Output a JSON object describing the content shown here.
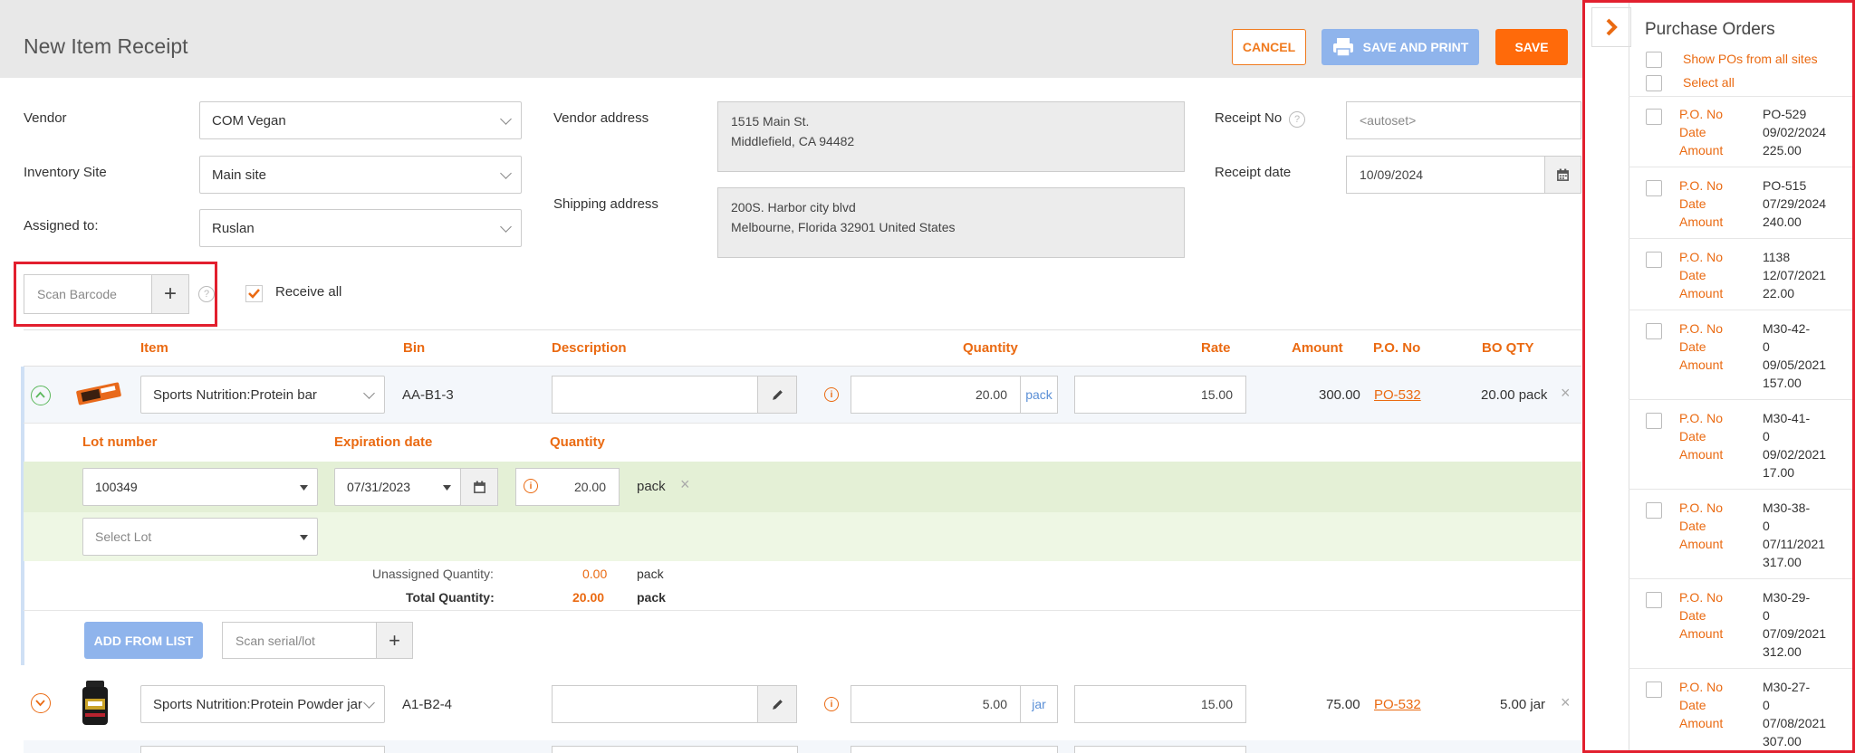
{
  "header": {
    "title": "New Item Receipt",
    "cancel_label": "CANCEL",
    "save_print_label": "SAVE AND PRINT",
    "save_label": "SAVE"
  },
  "form": {
    "vendor_label": "Vendor",
    "vendor_value": "COM Vegan",
    "site_label": "Inventory Site",
    "site_value": "Main site",
    "assigned_label": "Assigned to:",
    "assigned_value": "Ruslan",
    "vendor_address_label": "Vendor address",
    "vendor_address_line1": "1515 Main St.",
    "vendor_address_line2": "Middlefield, CA 94482",
    "shipping_address_label": "Shipping address",
    "shipping_address_line1": "200S. Harbor city blvd",
    "shipping_address_line2": "Melbourne, Florida 32901 United States",
    "receipt_no_label": "Receipt No",
    "receipt_no_placeholder": "<autoset>",
    "receipt_date_label": "Receipt date",
    "receipt_date_value": "10/09/2024",
    "scan_placeholder": "Scan Barcode",
    "receive_all_label": "Receive all"
  },
  "table": {
    "headers": {
      "item": "Item",
      "bin": "Bin",
      "description": "Description",
      "quantity": "Quantity",
      "rate": "Rate",
      "amount": "Amount",
      "po_no": "P.O. No",
      "bo_qty": "BO QTY"
    },
    "row1": {
      "item": "Sports Nutrition:Protein bar",
      "bin": "AA-B1-3",
      "quantity": "20.00",
      "unit": "pack",
      "rate": "15.00",
      "amount": "300.00",
      "po": "PO-532",
      "bo": "20.00 pack"
    },
    "lots": {
      "lot_header": "Lot number",
      "exp_header": "Expiration date",
      "qty_header": "Quantity",
      "lot_value": "100349",
      "exp_value": "07/31/2023",
      "qty_value": "20.00",
      "unit": "pack",
      "select_placeholder": "Select Lot",
      "unassigned_label": "Unassigned Quantity:",
      "unassigned_value": "0.00",
      "unassigned_unit": "pack",
      "total_label": "Total Quantity:",
      "total_value": "20.00",
      "total_unit": "pack",
      "add_from_list": "ADD FROM LIST",
      "scan_serial_placeholder": "Scan serial/lot"
    },
    "row2": {
      "item": "Sports Nutrition:Protein Powder jar",
      "bin": "A1-B2-4",
      "quantity": "5.00",
      "unit": "jar",
      "rate": "15.00",
      "amount": "75.00",
      "po": "PO-532",
      "bo": "5.00 jar"
    }
  },
  "sidebar": {
    "title": "Purchase Orders",
    "show_all_sites": "Show POs from all sites",
    "select_all": "Select all",
    "label_po": "P.O. No",
    "label_date": "Date",
    "label_amount": "Amount",
    "orders": [
      {
        "po": "PO-529",
        "date": "09/02/2024",
        "amount": "225.00"
      },
      {
        "po": "PO-515",
        "date": "07/29/2024",
        "amount": "240.00"
      },
      {
        "po": "1138",
        "date": "12/07/2021",
        "amount": "22.00"
      },
      {
        "po": "M30-42-",
        "po2": "0",
        "date": "09/05/2021",
        "amount": "157.00"
      },
      {
        "po": "M30-41-",
        "po2": "0",
        "date": "09/02/2021",
        "amount": "17.00"
      },
      {
        "po": "M30-38-",
        "po2": "0",
        "date": "07/11/2021",
        "amount": "317.00"
      },
      {
        "po": "M30-29-",
        "po2": "0",
        "date": "07/09/2021",
        "amount": "312.00"
      },
      {
        "po": "M30-27-",
        "po2": "0",
        "date": "07/08/2021",
        "amount": "307.00"
      }
    ]
  },
  "colors": {
    "accent": "#ea6a12",
    "save": "#ff6a0a",
    "save_print": "#8fb4ec",
    "highlight": "#e21f2e",
    "lot_row": "#e4f0d6"
  }
}
